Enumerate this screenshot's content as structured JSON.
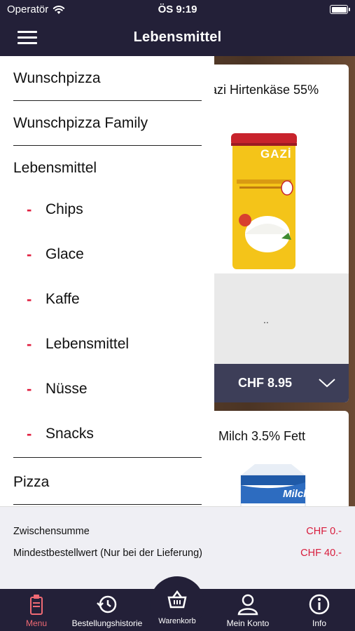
{
  "status_bar": {
    "carrier": "Operatör",
    "time": "ÖS 9:19"
  },
  "nav": {
    "title": "Lebensmittel"
  },
  "drawer": {
    "items": [
      {
        "label": "Wunschpizza"
      },
      {
        "label": "Wunschpizza Family"
      },
      {
        "label": "Lebensmittel"
      }
    ],
    "sub_items": [
      {
        "label": "Chips"
      },
      {
        "label": "Glace"
      },
      {
        "label": "Kaffe"
      },
      {
        "label": "Lebensmittel"
      },
      {
        "label": "Nüsse"
      },
      {
        "label": "Snacks"
      }
    ],
    "last_item": {
      "label": "Pizza"
    },
    "accent_color": "#e02040"
  },
  "products": [
    {
      "name": "azi Hirtenkäse 55%",
      "description": "..",
      "price": "CHF 8.95",
      "brand_text": "GAZİ"
    },
    {
      "name": "Milch 3.5% Fett",
      "brand_text": "Milch"
    }
  ],
  "totals": {
    "subtotal_label": "Zwischensumme",
    "subtotal_value": "CHF 0.-",
    "min_order_label": "Mindestbestellwert (Nur bei der Lieferung)",
    "min_order_value": "CHF 40.-"
  },
  "tabs": [
    {
      "label": "Menu",
      "icon": "menu-book-icon",
      "active": true
    },
    {
      "label": "Bestellungshistorie",
      "icon": "history-icon",
      "active": false
    },
    {
      "label": "Warenkorb",
      "icon": "basket-icon",
      "active": false
    },
    {
      "label": "Mein Konto",
      "icon": "user-icon",
      "active": false
    },
    {
      "label": "Info",
      "icon": "info-icon",
      "active": false
    }
  ],
  "colors": {
    "navy": "#232038",
    "price_bar": "#3d3e58",
    "red": "#d81c3c",
    "active_tab": "#f06a74"
  }
}
